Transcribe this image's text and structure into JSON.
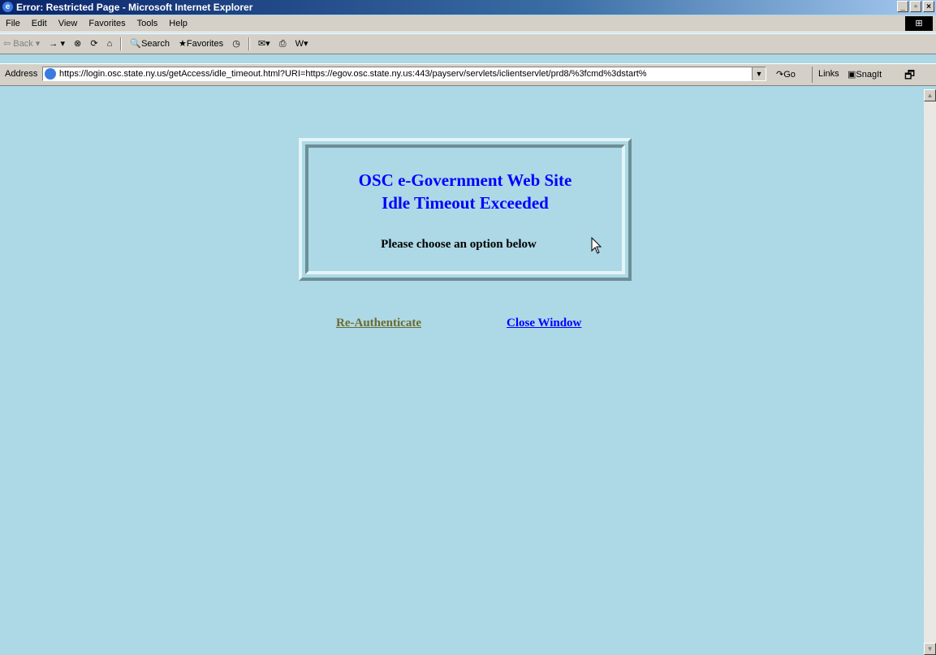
{
  "window": {
    "title": "Error: Restricted Page - Microsoft Internet Explorer",
    "controls": [
      "_",
      "▫",
      "×"
    ]
  },
  "menu": {
    "items": [
      "File",
      "Edit",
      "View",
      "Favorites",
      "Tools",
      "Help"
    ]
  },
  "toolbar": {
    "back_label": "Back",
    "forward_label": "→",
    "search_label": "Search",
    "favorites_label": "Favorites"
  },
  "address": {
    "label": "Address",
    "url": "https://login.osc.state.ny.us/getAccess/idle_timeout.html?URI=https://egov.osc.state.ny.us:443/payserv/servlets/iclientservlet/prd8/%3fcmd%3dstart%",
    "go_label": "Go",
    "links_label": "Links",
    "snagit_label": "SnagIt"
  },
  "page": {
    "heading_line1": "OSC e-Government Web Site",
    "heading_line2": "Idle Timeout Exceeded",
    "instruction": "Please choose an option below",
    "reauth_label": "Re-Authenticate",
    "close_label": "Close Window"
  },
  "colors": {
    "page_background": "#ADD8E6",
    "heading": "#0000FF",
    "reauth_link": "#6B6B2F",
    "close_link": "#0000FF"
  }
}
